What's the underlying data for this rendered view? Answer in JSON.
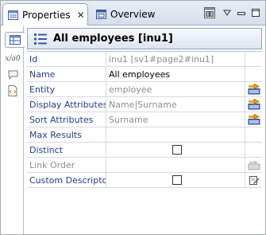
{
  "tabs": [
    {
      "label": "Properties",
      "icon": "properties-icon",
      "active": true,
      "closable": true
    },
    {
      "label": "Overview",
      "icon": "overview-icon",
      "active": false
    }
  ],
  "toolbar": {
    "layout_icon": "view-layout-icon",
    "menu_icon": "view-menu-icon",
    "minimize_icon": "minimize-icon",
    "maximize_icon": "maximize-icon"
  },
  "vtabs": [
    {
      "name": "table-icon",
      "active": true
    },
    {
      "name": "xpath-icon",
      "label": "x/a0"
    },
    {
      "name": "comment-icon"
    },
    {
      "name": "code-icon"
    }
  ],
  "title": "All employees [inu1]",
  "properties": [
    {
      "label": "Id",
      "value": "inu1  [sv1#page2#inu1]",
      "value_muted": true,
      "label_disabled": false,
      "button": null
    },
    {
      "label": "Name",
      "value": "All employees",
      "value_muted": false,
      "label_disabled": false,
      "button": null,
      "selected": true
    },
    {
      "label": "Entity",
      "value": "employee",
      "value_muted": true,
      "label_disabled": false,
      "button": "choose-entity"
    },
    {
      "label": "Display Attributes",
      "value": "Name|Surname",
      "value_muted": true,
      "label_disabled": false,
      "button": "choose-display-attributes"
    },
    {
      "label": "Sort Attributes",
      "value": "Surname",
      "value_muted": true,
      "label_disabled": false,
      "button": "choose-sort-attributes"
    },
    {
      "label": "Max Results",
      "value": "",
      "value_muted": false,
      "label_disabled": false,
      "button": null
    },
    {
      "label": "Distinct",
      "value": "",
      "checkbox": true,
      "checked": false,
      "label_disabled": false,
      "button": null
    },
    {
      "label": "Link Order",
      "value": "",
      "value_muted": false,
      "label_disabled": true,
      "button": "choose-link-order-disabled"
    },
    {
      "label": "Custom Descriptor",
      "value": "",
      "checkbox": true,
      "checked": false,
      "label_disabled": false,
      "button": "edit-descriptor"
    }
  ]
}
